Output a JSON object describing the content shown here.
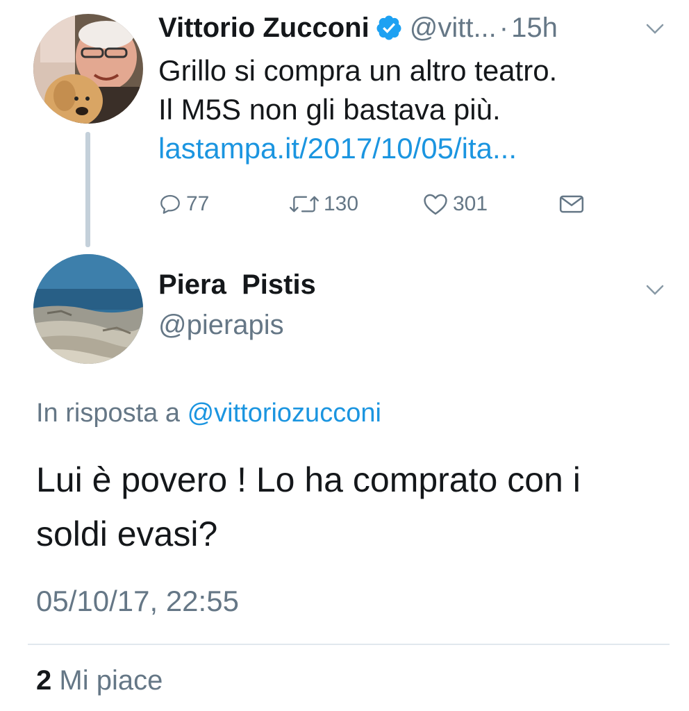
{
  "original_tweet": {
    "display_name": "Vittorio Zucconi",
    "handle_truncated": "@vitt...",
    "separator": "·",
    "time": "15h",
    "text_lines": [
      "Grillo si compra un altro teatro.",
      "Il M5S non gli bastava più."
    ],
    "link": "lastampa.it/2017/10/05/ita...",
    "actions": {
      "reply_count": "77",
      "retweet_count": "130",
      "like_count": "301"
    },
    "verified_color": "#1da1f2"
  },
  "reply_tweet": {
    "display_name": "Piera  Pistis",
    "handle": "@pierapis",
    "in_reply_prefix": "In risposta a",
    "in_reply_mention": "@vittoriozucconi",
    "text_lines": [
      "Lui è povero ! Lo ha comprato con i",
      "soldi evasi?"
    ],
    "timestamp": "05/10/17, 22:55",
    "likes": {
      "count": "2",
      "label": "Mi piace"
    }
  },
  "colors": {
    "link": "#1b95e0",
    "secondary_text": "#657786",
    "primary_text": "#14171a",
    "thread_line": "#c4d0da"
  },
  "icons": [
    "chevron-down-icon",
    "verified-badge-icon",
    "reply-icon",
    "retweet-icon",
    "like-heart-icon",
    "direct-message-icon"
  ]
}
